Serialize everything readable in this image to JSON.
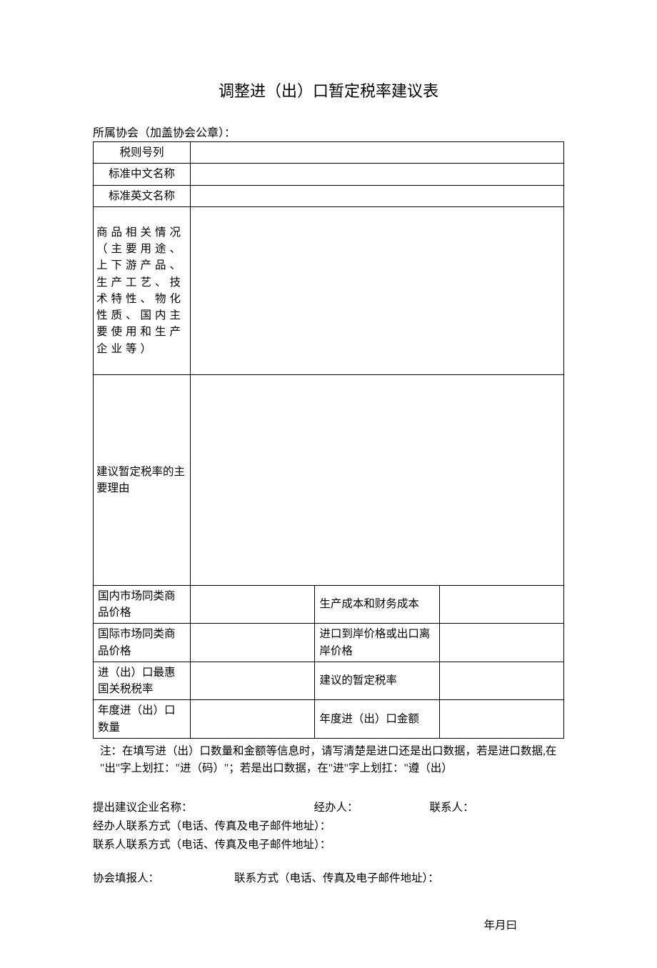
{
  "title": "调整进（出）口暂定税率建议表",
  "subtitle": "所属协会（加盖协会公章）：",
  "rows": {
    "tax_code": "税则号列",
    "name_cn": "标准中文名称",
    "name_en": "标准英文名称",
    "product_info": "商品相关情况（主要用途、上下游产品、生产工艺、技术特性、物化性质、国内主要使用和生产企业等）",
    "reason": "建议暂定税率的主要理由",
    "domestic_price": "国内市场同类商品价格",
    "production_cost": "生产成本和财务成本",
    "intl_price": "国际市场同类商品价格",
    "import_export_price": "进口到岸价格或出口离岸价格",
    "mfn_rate": "进（出）口最惠国关税税率",
    "suggested_rate": "建议的暂定税率",
    "annual_qty": "年度进（出）口数量",
    "annual_amount": "年度进（出）口金额"
  },
  "note_line1": "注：在填写进（出）口数量和金额等信息时，请写清楚是进口还是出口数据，若是进口数据,在",
  "note_line2": "\"出\"字上划扛：\"进（码）\"；若是出口数据，在\"进\"字上划扛：\"遵（出）",
  "footer": {
    "company_label": "提出建议企业名称：",
    "handler_label": "经办人：",
    "contact_label": "联系人：",
    "handler_contact": "经办人联系方式（电话、传真及电子邮件地址）：",
    "contact_contact": "联系人联系方式（电话、传真及电子邮件地址）：",
    "assoc_reporter": "协会填报人：",
    "assoc_contact": "联系方式（电话、传真及电子邮件地址）：",
    "date": "年月曰"
  }
}
